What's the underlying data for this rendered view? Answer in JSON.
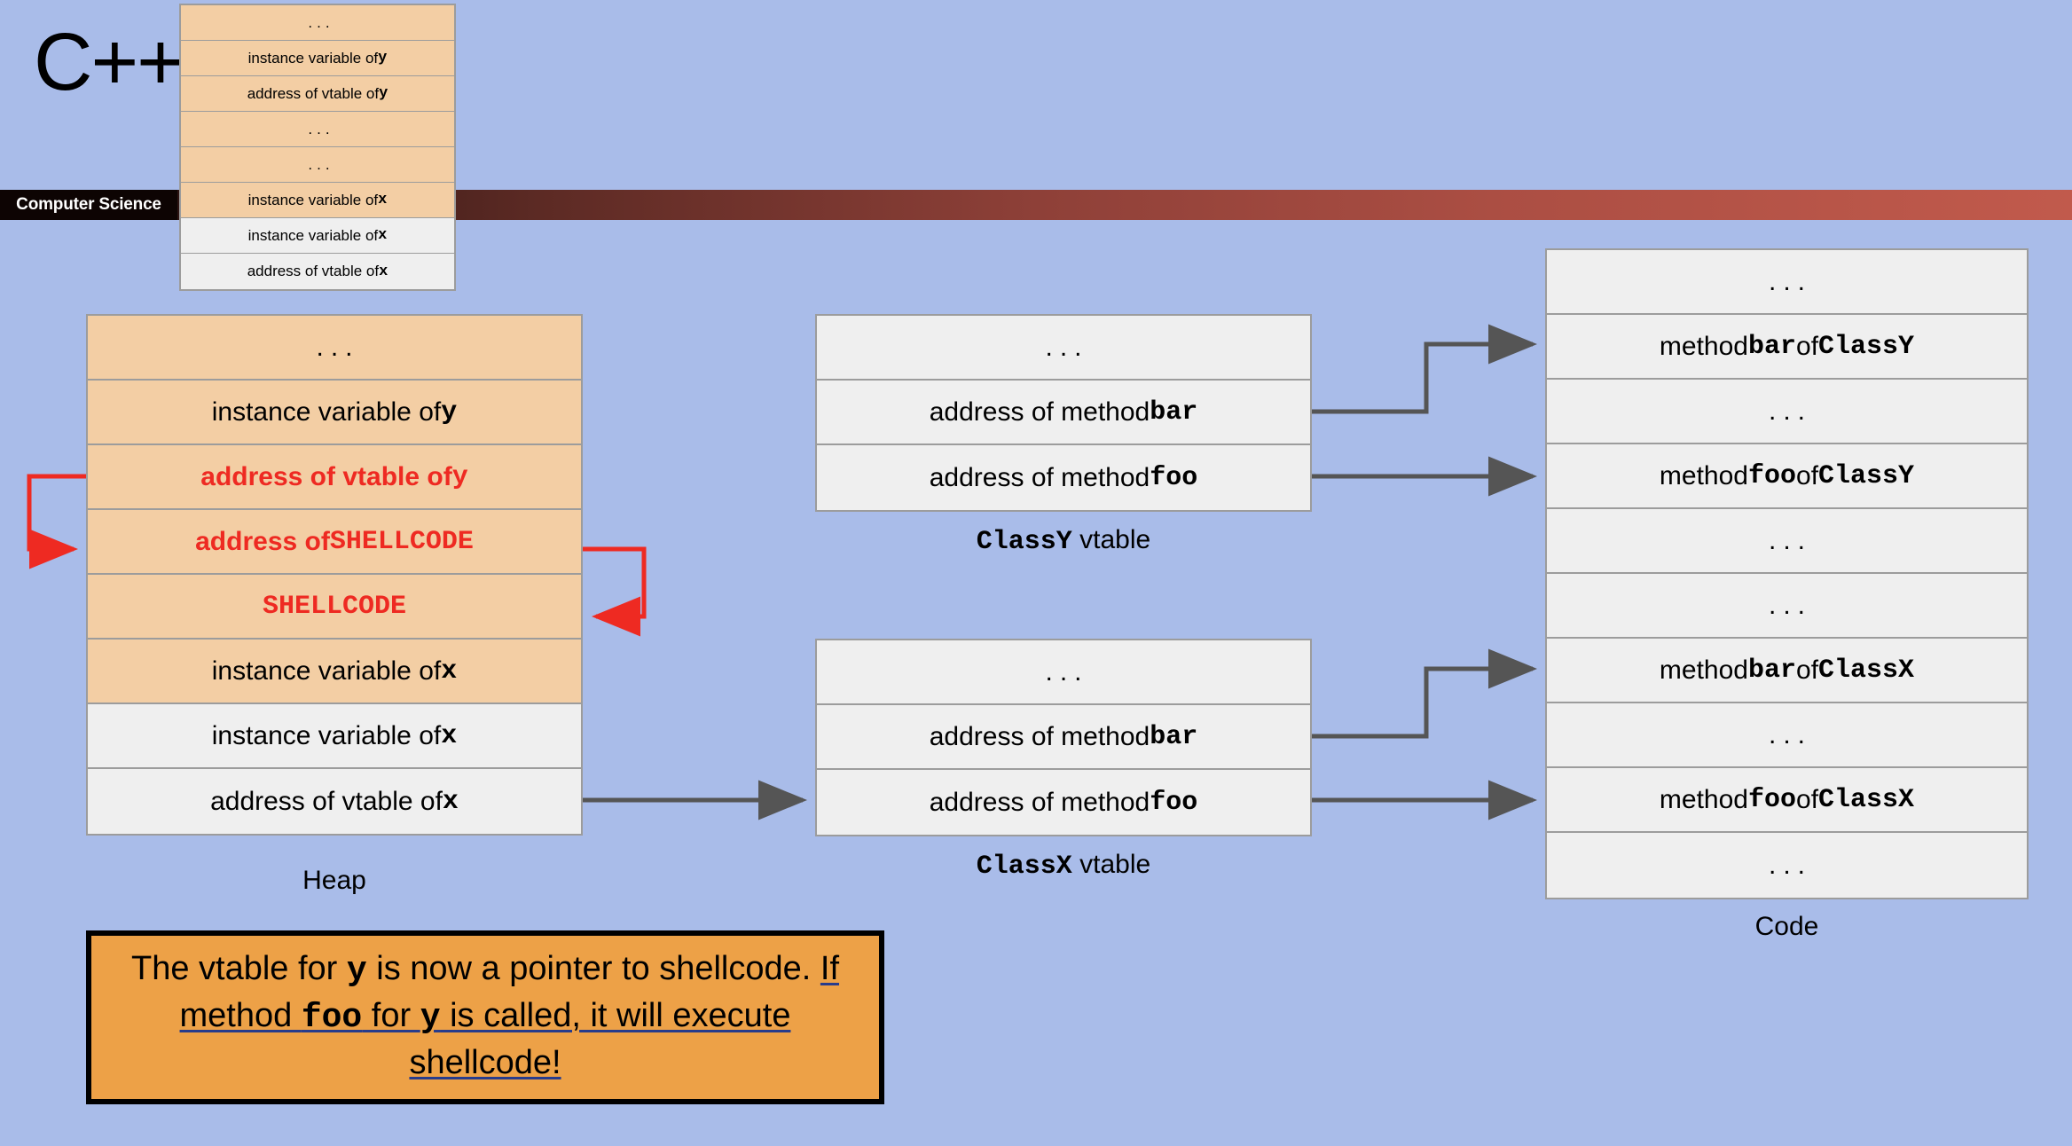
{
  "slide": {
    "title": "C++",
    "badge": "Computer Science",
    "background_color": "#a9bce9",
    "banner_from_color": "#1e0d0c",
    "banner_to_color": "#c15a4c"
  },
  "overlay_table": {
    "name": "previous-heap-state",
    "rows": [
      {
        "text": "...",
        "kind": "dots",
        "fill": "orange"
      },
      {
        "text": "instance variable of ",
        "mono": "y",
        "fill": "orange"
      },
      {
        "text": "address of vtable of ",
        "mono": "y",
        "fill": "orange"
      },
      {
        "text": "...",
        "kind": "dots",
        "fill": "orange"
      },
      {
        "text": "...",
        "kind": "dots",
        "fill": "orange"
      },
      {
        "text": "instance variable of ",
        "mono": "x",
        "fill": "orange"
      },
      {
        "text": "instance variable of ",
        "mono": "x",
        "fill": "gray"
      },
      {
        "text": "address of vtable of ",
        "mono": "x",
        "fill": "gray"
      }
    ]
  },
  "heap": {
    "caption": "Heap",
    "rows": [
      {
        "text": "...",
        "kind": "dots",
        "fill": "orange",
        "color": "black"
      },
      {
        "text": "instance variable of ",
        "mono": "y",
        "fill": "orange",
        "color": "black"
      },
      {
        "text": "address of vtable of ",
        "mono": "y",
        "fill": "orange",
        "color": "red"
      },
      {
        "text": "address of ",
        "mono": "SHELLCODE",
        "fill": "orange",
        "color": "red"
      },
      {
        "text": "",
        "mono": "SHELLCODE",
        "fill": "orange",
        "color": "red"
      },
      {
        "text": "instance variable of ",
        "mono": "x",
        "fill": "orange",
        "color": "black"
      },
      {
        "text": "instance variable of ",
        "mono": "x",
        "fill": "gray",
        "color": "black"
      },
      {
        "text": "address of vtable of ",
        "mono": "x",
        "fill": "gray",
        "color": "black"
      }
    ]
  },
  "classy_vtable": {
    "caption_mono": "ClassY",
    "caption_rest": " vtable",
    "rows": [
      {
        "text": "...",
        "kind": "dots",
        "fill": "gray"
      },
      {
        "text": "address of method ",
        "mono": "bar",
        "fill": "gray"
      },
      {
        "text": "address of method ",
        "mono": "foo",
        "fill": "gray"
      }
    ]
  },
  "classx_vtable": {
    "caption_mono": "ClassX",
    "caption_rest": " vtable",
    "rows": [
      {
        "text": "...",
        "kind": "dots",
        "fill": "gray"
      },
      {
        "text": "address of method ",
        "mono": "bar",
        "fill": "gray"
      },
      {
        "text": "address of method ",
        "mono": "foo",
        "fill": "gray"
      }
    ]
  },
  "code": {
    "caption": "Code",
    "rows": [
      {
        "text": "...",
        "kind": "dots",
        "fill": "gray"
      },
      {
        "pre": "method ",
        "mono": "bar",
        "mid": " of ",
        "mono2": "ClassY",
        "fill": "gray"
      },
      {
        "text": "...",
        "kind": "dots",
        "fill": "gray"
      },
      {
        "pre": "method ",
        "mono": "foo",
        "mid": " of ",
        "mono2": "ClassY",
        "fill": "gray"
      },
      {
        "text": "...",
        "kind": "dots",
        "fill": "gray"
      },
      {
        "text": "...",
        "kind": "dots",
        "fill": "gray"
      },
      {
        "pre": "method ",
        "mono": "bar",
        "mid": " of ",
        "mono2": "ClassX",
        "fill": "gray"
      },
      {
        "text": "...",
        "kind": "dots",
        "fill": "gray"
      },
      {
        "pre": "method ",
        "mono": "foo",
        "mid": " of ",
        "mono2": "ClassX",
        "fill": "gray"
      },
      {
        "text": "...",
        "kind": "dots",
        "fill": "gray"
      }
    ]
  },
  "callout": {
    "line1_a": "The vtable for ",
    "line1_mono": "y",
    "line1_b": " is now a pointer to shellcode. ",
    "u1": "If method ",
    "u_mono": "foo",
    "u2": " for ",
    "u_mono2": "y",
    "u3": " is called, it will execute shellcode!",
    "underline_color": "#283c8c",
    "fill_color": "#eda147"
  },
  "arrow_colors": {
    "pointer": "#555555",
    "attack": "#ee2a22"
  }
}
